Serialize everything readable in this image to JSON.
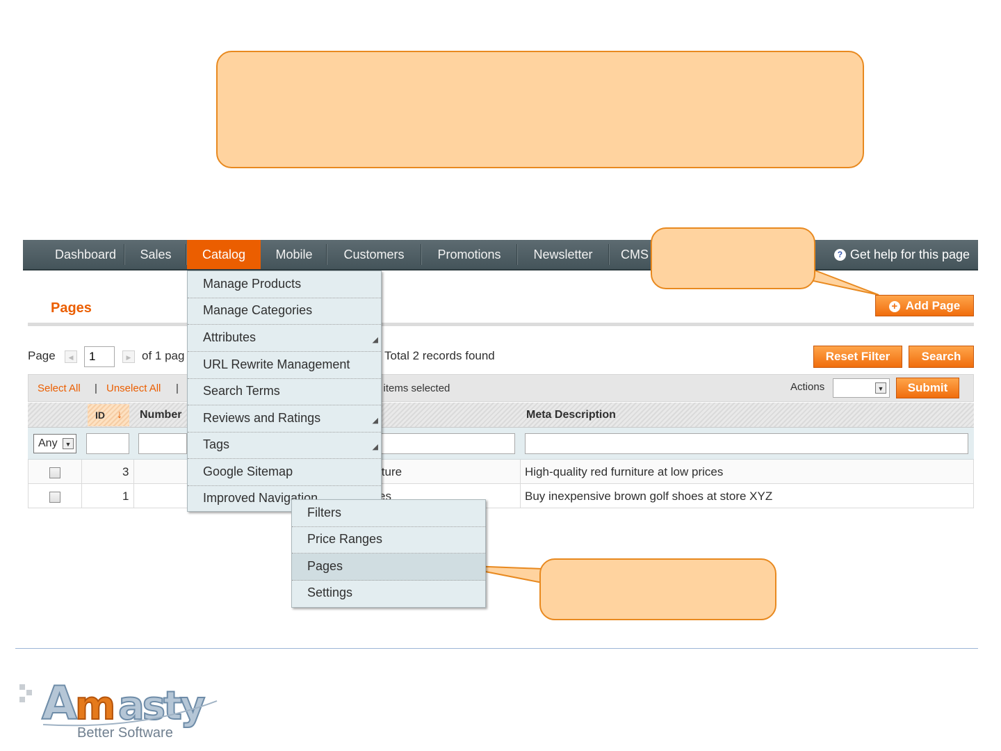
{
  "nav": {
    "items": [
      "Dashboard",
      "Sales",
      "Catalog",
      "Mobile",
      "Customers",
      "Promotions",
      "Newsletter",
      "CMS"
    ],
    "active": "Catalog",
    "help": "Get help for this page"
  },
  "page": {
    "title": "Pages",
    "add_button": "Add Page"
  },
  "pager": {
    "page_label": "Page",
    "current_page": "1",
    "of_pages": "of 1 pag",
    "records": "Total 2 records found",
    "reset_filter": "Reset Filter",
    "search": "Search"
  },
  "massaction": {
    "select_all": "Select All",
    "unselect_all": "Unselect All",
    "items_selected": "0 items selected",
    "actions_label": "Actions",
    "submit": "Submit"
  },
  "grid": {
    "columns": [
      "ID",
      "Number",
      "Meta Description"
    ],
    "filter_any": "Any",
    "rows": [
      {
        "id": "3",
        "title_fragment": "iture",
        "meta": "High-quality red furniture at low prices"
      },
      {
        "id": "1",
        "title_fragment": "es",
        "meta": "Buy inexpensive brown golf shoes at store XYZ"
      }
    ]
  },
  "catalog_menu": {
    "items": [
      "Manage Products",
      "Manage Categories",
      "Attributes",
      "URL Rewrite Management",
      "Search Terms",
      "Reviews and Ratings",
      "Tags",
      "Google Sitemap",
      "Improved Navigation"
    ]
  },
  "submenu": {
    "items": [
      "Filters",
      "Price Ranges",
      "Pages",
      "Settings"
    ],
    "highlighted": "Pages"
  },
  "logo": {
    "brand": "Amasty",
    "tagline": "Better Software"
  },
  "colors": {
    "accent": "#eb5e00",
    "callout_fill": "#ffd39f",
    "callout_border": "#e8891f",
    "nav_bg": "#4f5f65"
  }
}
